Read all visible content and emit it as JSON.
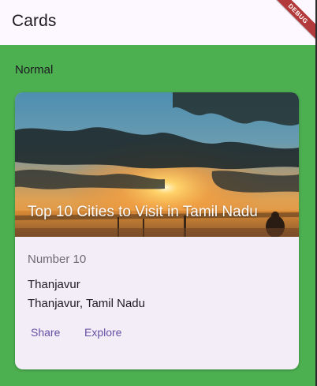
{
  "appbar": {
    "title": "Cards",
    "debug_banner": "DEBUG"
  },
  "section": {
    "label": "Normal"
  },
  "card": {
    "image_title": "Top 10 Cities to Visit in Tamil Nadu",
    "subtitle": "Number 10",
    "lines": [
      "Thanjavur",
      "Thanjavur, Tamil Nadu"
    ],
    "actions": [
      "Share",
      "Explore"
    ]
  },
  "colors": {
    "background_green": "#4caf50",
    "appbar_bg": "#fdf7ff",
    "card_bg": "#f3edf7",
    "action_purple": "#6750a4",
    "debug_red": "#b33a3a"
  }
}
